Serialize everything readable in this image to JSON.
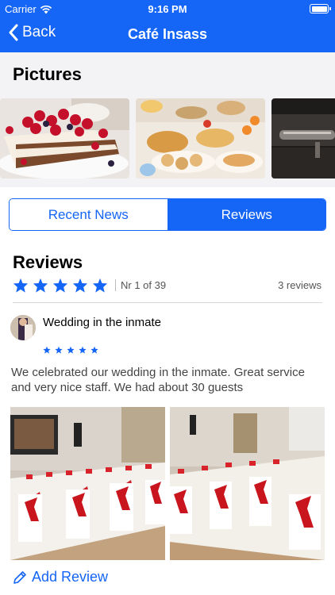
{
  "status_bar": {
    "carrier": "Carrier",
    "time": "9:16 PM"
  },
  "nav": {
    "back_label": "Back",
    "title": "Café Insass"
  },
  "pictures": {
    "heading": "Pictures",
    "items": [
      {
        "subject": "raspberry-cake-image"
      },
      {
        "subject": "breakfast-buffet-image"
      },
      {
        "subject": "coffee-machine-image"
      }
    ]
  },
  "tabs": [
    {
      "label": "Recent News",
      "selected": false
    },
    {
      "label": "Reviews",
      "selected": true
    }
  ],
  "reviews": {
    "heading": "Reviews",
    "rating": 5,
    "rank": "Nr 1 of 39",
    "count": "3 reviews",
    "items": [
      {
        "title": "Wedding in the inmate",
        "rating": 5,
        "text": "We celebrated our wedding in the inmate. Great service and very nice staff. We had about 30 guests",
        "photos": [
          "wedding-hall-photo-1",
          "wedding-hall-photo-2"
        ]
      }
    ]
  },
  "actions": {
    "add_review": "Add Review"
  },
  "colors": {
    "accent": "#1565f6",
    "star": "#1565f6",
    "section_bg": "#f3f3f5"
  }
}
